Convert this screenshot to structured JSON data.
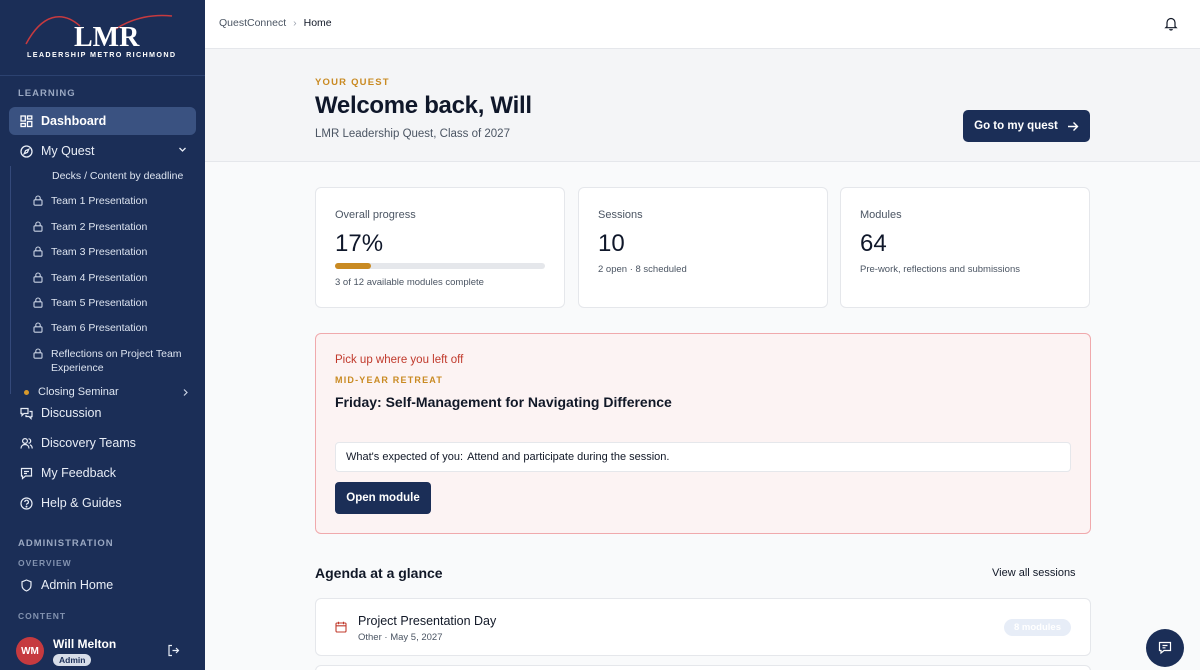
{
  "brand": {
    "logo_text": "LMR",
    "logo_subtitle": "LEADERSHIP METRO RICHMOND",
    "colors": {
      "sidebar": "#1b2e57",
      "accent": "#c98a22",
      "alert": "#c0392b"
    }
  },
  "sidebar": {
    "learning_label": "LEARNING",
    "dashboard": {
      "label": "Dashboard",
      "icon": "grid-icon"
    },
    "my_quest": {
      "label": "My Quest",
      "icon": "compass-icon"
    },
    "quest_items": [
      {
        "label": "Decks / Content by deadline",
        "locked": false
      },
      {
        "label": "Team 1 Presentation",
        "locked": true
      },
      {
        "label": "Team 2 Presentation",
        "locked": true
      },
      {
        "label": "Team 3 Presentation",
        "locked": true
      },
      {
        "label": "Team 4 Presentation",
        "locked": true
      },
      {
        "label": "Team 5 Presentation",
        "locked": true
      },
      {
        "label": "Team 6 Presentation",
        "locked": true
      },
      {
        "label": "Reflections on Project Team Experience",
        "locked": true
      }
    ],
    "closing_seminar": "Closing Seminar",
    "discussion": "Discussion",
    "discovery_teams": "Discovery Teams",
    "my_feedback": "My Feedback",
    "help_guides": "Help & Guides",
    "admin_label": "ADMINISTRATION",
    "overview_label": "OVERVIEW",
    "admin_home": "Admin Home",
    "content_label": "CONTENT",
    "user": {
      "initials": "WM",
      "name": "Will Melton",
      "role": "Admin"
    }
  },
  "topbar": {
    "breadcrumb_root": "QuestConnect",
    "breadcrumb_sep": "›",
    "breadcrumb_current": "Home"
  },
  "hero": {
    "eyebrow": "YOUR QUEST",
    "title": "Welcome back, Will",
    "subtitle": "LMR Leadership Quest, Class of 2027",
    "cta": "Go to my quest"
  },
  "stats": {
    "progress": {
      "label": "Overall progress",
      "value": "17%",
      "fraction": 0.17,
      "note": "3 of 12 available modules complete"
    },
    "sessions": {
      "label": "Sessions",
      "value": "10",
      "note": "2 open · 8 scheduled"
    },
    "modules": {
      "label": "Modules",
      "value": "64",
      "note": "Pre-work, reflections and submissions"
    }
  },
  "pickup": {
    "heading": "Pick up where you left off",
    "eyebrow": "MID-YEAR RETREAT",
    "title": "Friday: Self-Management for Navigating Difference",
    "expect_label": "What's expected of you:",
    "expect_text": "Attend and participate during the session.",
    "button": "Open module"
  },
  "agenda": {
    "title": "Agenda at a glance",
    "view_all": "View all sessions",
    "rows": [
      {
        "title": "Project Presentation Day",
        "meta": "Other · May 5, 2027",
        "badge": "8 modules"
      }
    ]
  }
}
